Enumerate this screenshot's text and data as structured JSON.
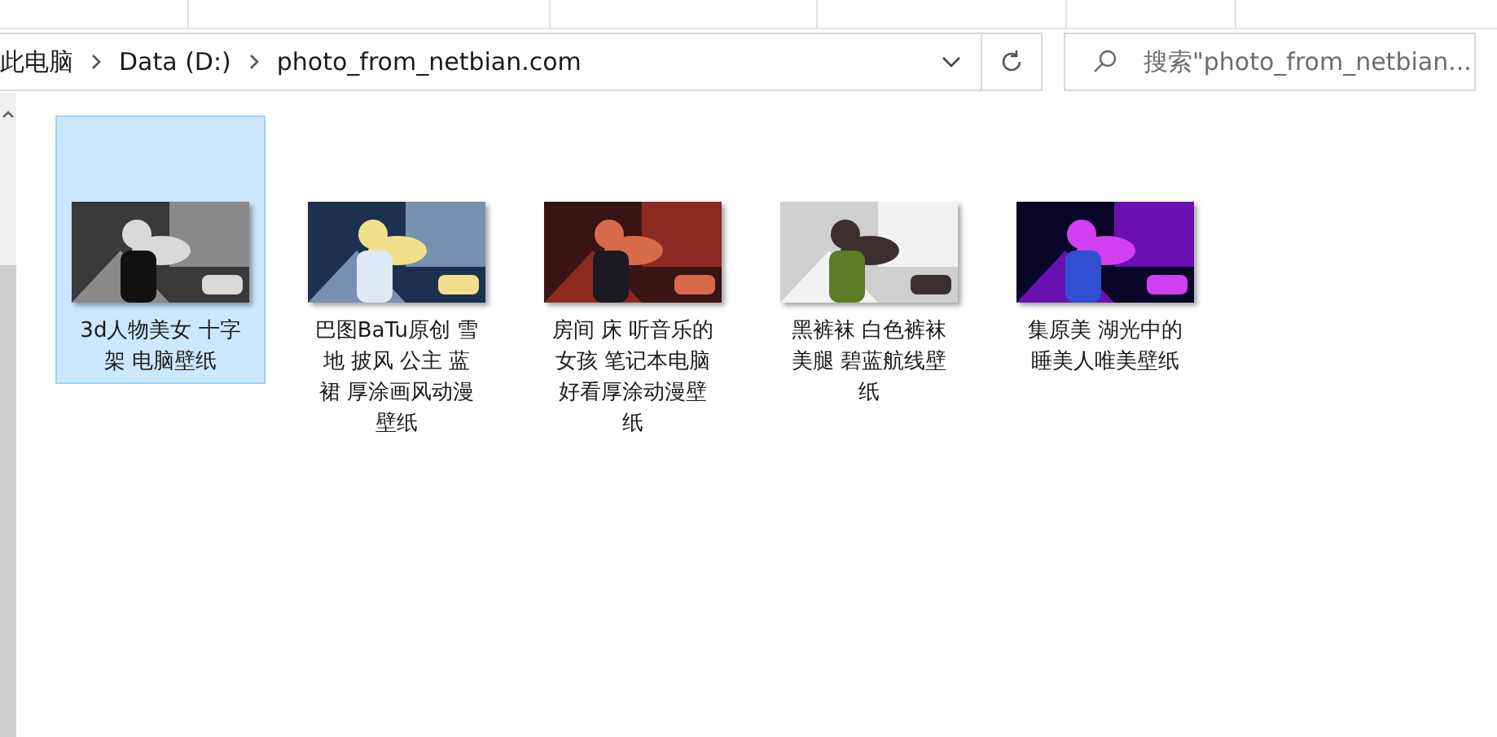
{
  "address_bar": {
    "breadcrumbs": [
      "此电脑",
      "Data (D:)",
      "photo_from_netbian.com"
    ]
  },
  "search": {
    "placeholder": "搜索\"photo_from_netbian..."
  },
  "files": [
    {
      "name": "3d人物美女 十字架 电脑壁纸",
      "selected": true
    },
    {
      "name": "巴图BaTu原创 雪地 披风 公主 蓝裙 厚涂画风动漫壁纸",
      "selected": false
    },
    {
      "name": "房间 床 听音乐的女孩 笔记本电脑好看厚涂动漫壁纸",
      "selected": false
    },
    {
      "name": "黑裤袜 白色裤袜美腿 碧蓝航线壁纸",
      "selected": false
    },
    {
      "name": "集原美 湖光中的睡美人唯美壁纸",
      "selected": false
    }
  ]
}
